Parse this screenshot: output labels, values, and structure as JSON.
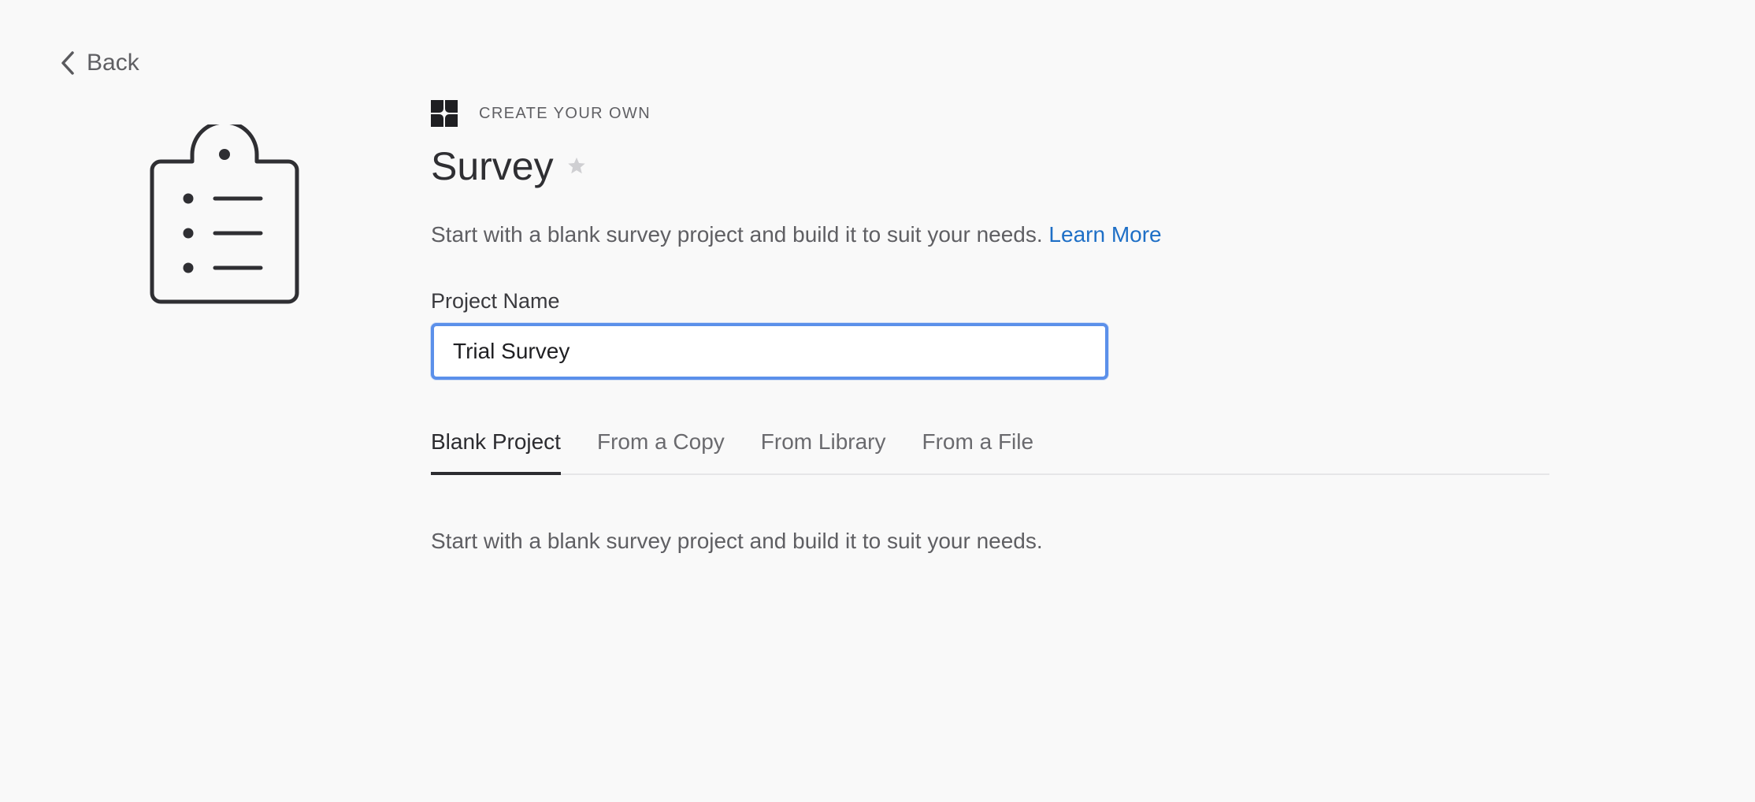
{
  "nav": {
    "back_label": "Back",
    "back_icon": "chevron-left-icon"
  },
  "hero": {
    "icon": "clipboard-list-icon"
  },
  "header": {
    "eyebrow": "CREATE YOUR OWN",
    "eyebrow_icon": "qualtrics-logo-icon",
    "title": "Survey",
    "favorite_icon": "star-icon"
  },
  "description": {
    "text": "Start with a blank survey project and build it to suit your needs.",
    "link_label": "Learn More"
  },
  "form": {
    "project_name_label": "Project Name",
    "project_name_value": "Trial Survey"
  },
  "tabs": [
    {
      "label": "Blank Project",
      "active": true
    },
    {
      "label": "From a Copy",
      "active": false
    },
    {
      "label": "From Library",
      "active": false
    },
    {
      "label": "From a File",
      "active": false
    }
  ],
  "tab_content": {
    "text": "Start with a blank survey project and build it to suit your needs."
  },
  "colors": {
    "background": "#f9f9f9",
    "link": "#1e6fc6",
    "input_focus_border": "#5b90ea",
    "text_primary": "#2c2c2e",
    "text_secondary": "#5f5f63"
  }
}
